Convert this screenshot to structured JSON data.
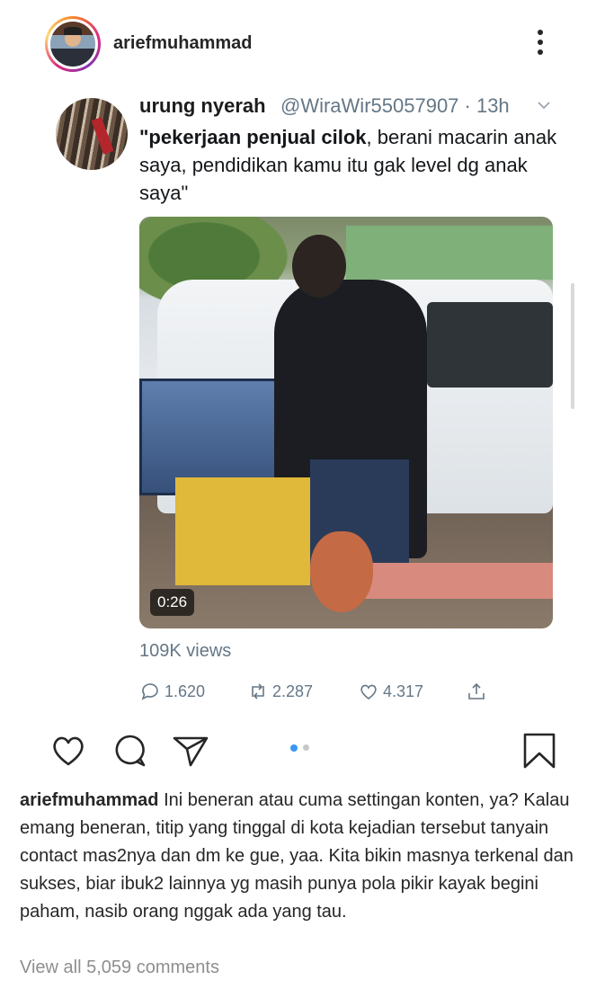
{
  "post": {
    "username": "ariefmuhammad"
  },
  "tweet": {
    "display_name": "urung nyerah",
    "handle_time": "@WiraWir55057907 · 13h",
    "text_bold": "\"pekerjaan penjual cilok",
    "text_rest": ", berani macarin anak saya, pendidikan kamu itu gak level dg anak saya\"",
    "video_duration": "0:26",
    "views": "109K views",
    "replies": "1.620",
    "retweets": "2.287",
    "likes": "4.317"
  },
  "carousel": {
    "active_color": "#3897f0",
    "inactive_color": "#c7c7c7"
  },
  "caption": {
    "username": "ariefmuhammad",
    "text": "Ini beneran atau cuma settingan konten, ya? Kalau emang beneran, titip yang tinggal di kota kejadian tersebut tanyain contact mas2nya dan dm ke gue, yaa. Kita bikin masnya terkenal dan sukses, biar ibuk2 lainnya yg masih punya pola pikir kayak begini paham, nasib orang nggak ada yang tau."
  },
  "comments": {
    "view_all": "View all 5,059 comments"
  },
  "icons": {
    "header": [
      "avatar",
      "more-vertical-icon"
    ],
    "tweet": [
      "chevron-down-icon",
      "reply-icon",
      "retweet-icon",
      "like-icon",
      "share-icon"
    ],
    "actions": [
      "heart-icon",
      "comment-icon",
      "send-icon",
      "bookmark-icon"
    ]
  }
}
